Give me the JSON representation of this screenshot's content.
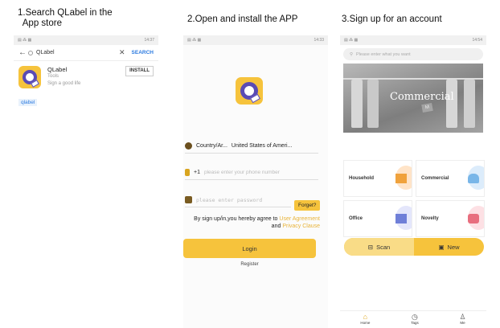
{
  "captions": {
    "step1": "1.Search QLabel in the\n  App store",
    "step2": "2.Open and install the APP",
    "step3": "3.Sign up for an account"
  },
  "phone1": {
    "status": "14:37",
    "query": "QLabel",
    "search_btn": "SEARCH",
    "app_name": "QLabel",
    "app_cat": "Tools",
    "app_tag": "Sign a good life",
    "install": "INSTALL",
    "suggest": "qlabel"
  },
  "phone2": {
    "status": "14:33",
    "country_label": "Country/Ar...",
    "country_value": "United States of Ameri...",
    "code": "+1",
    "phone_ph": "please enter your phone number",
    "pwd_ph": "please enter password",
    "forgot": "Forget?",
    "agree_text": "By sign up/in,you hereby agree to",
    "agree_link1": "User Agreement",
    "agree_and": "and",
    "agree_link2": "Privacy Clause",
    "login": "Login",
    "register": "Register"
  },
  "phone3": {
    "status": "14:54",
    "search_ph": "Please enter what you want",
    "banner_title": "Commercial",
    "banner_tag": "M",
    "categories": [
      "Household",
      "Commercial",
      "Office",
      "Novelty"
    ],
    "tab_scan": "Scan",
    "tab_new": "New",
    "nav": [
      "Home",
      "Tags",
      "Me"
    ]
  },
  "colors": {
    "accent": "#f6c33c",
    "brand_purple": "#5a4bb5",
    "link_blue": "#2d7be0"
  },
  "icons": [
    "back-arrow-icon",
    "search-icon",
    "close-icon",
    "qlabel-app-icon",
    "flag-icon",
    "phone-icon",
    "lock-icon",
    "scan-icon",
    "new-icon",
    "home-icon",
    "clock-icon",
    "person-icon"
  ]
}
